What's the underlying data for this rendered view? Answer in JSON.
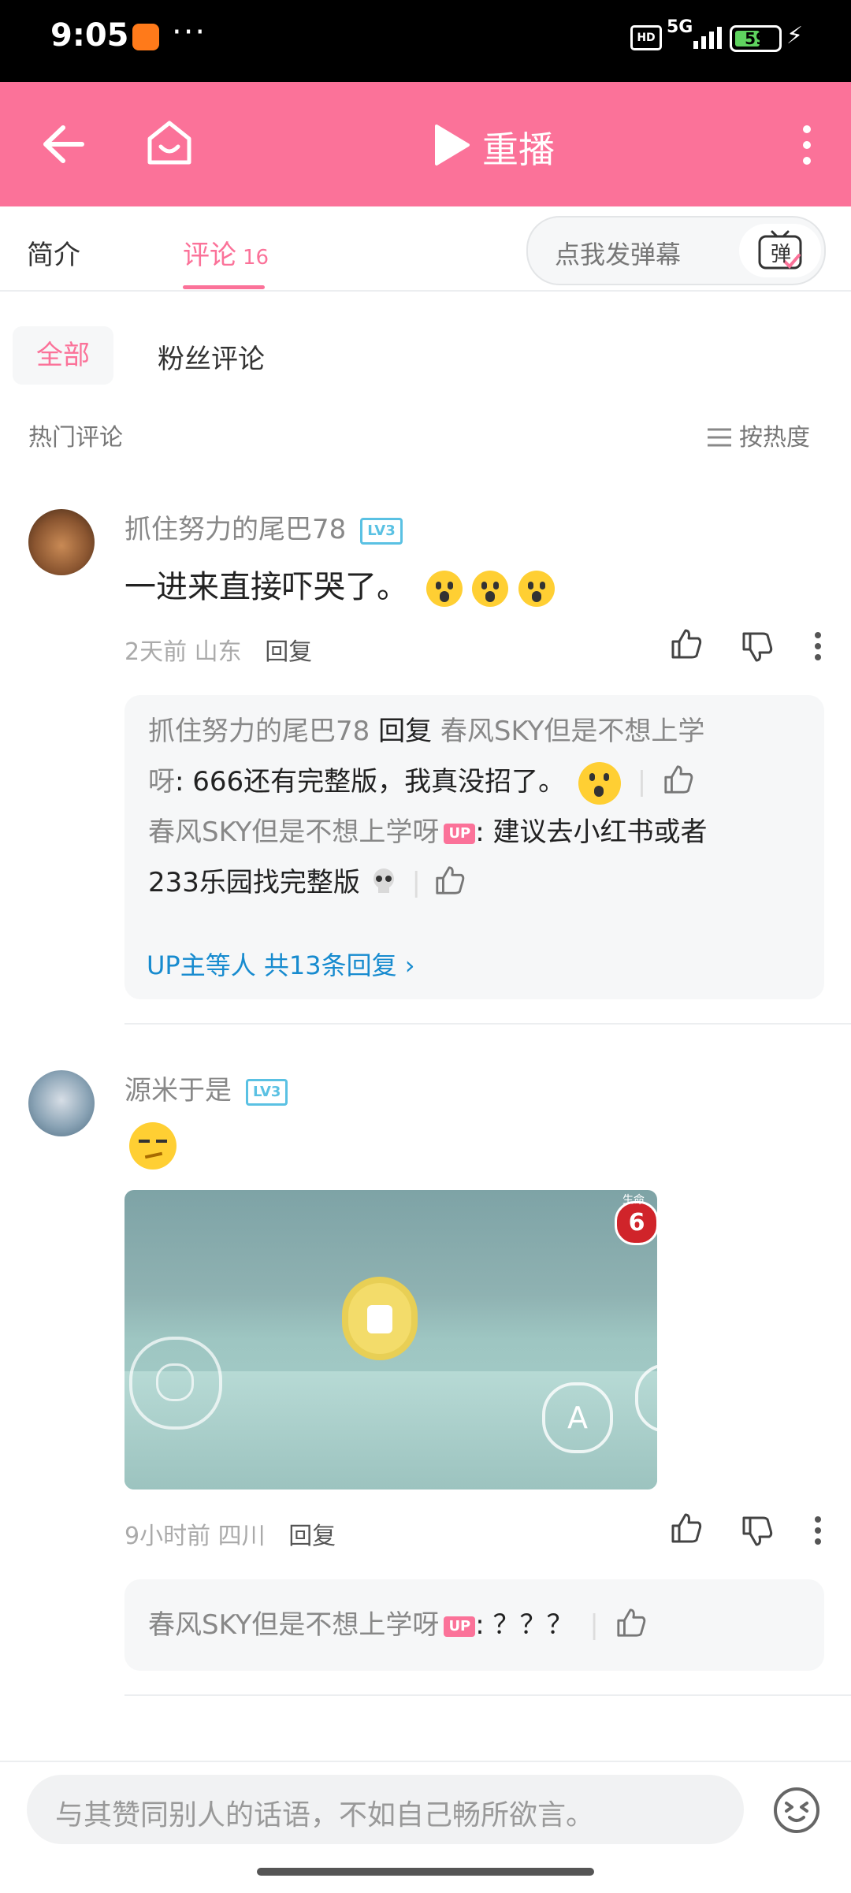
{
  "status_bar": {
    "time": "9:05",
    "more": "···",
    "hd": "HD",
    "signal": "5G",
    "battery": "59",
    "battery_fraction": 0.59
  },
  "nav": {
    "title": "重播"
  },
  "tabs": [
    {
      "label": "简介"
    },
    {
      "label": "评论",
      "count": "16"
    }
  ],
  "danmu": {
    "placeholder": "点我发弹幕",
    "icon_text": "弹"
  },
  "filters": {
    "all": "全部",
    "fans": "粉丝评论"
  },
  "section": {
    "title": "热门评论",
    "sort": "按热度"
  },
  "comments": [
    {
      "user": "抓住努力的尾巴78",
      "level": "LV3",
      "text": "一进来直接吓哭了。",
      "emojis": [
        "scream-emoji",
        "scream-emoji",
        "scream-emoji"
      ],
      "time": "2天前",
      "location": "山东",
      "reply": "回复",
      "replies": [
        {
          "user": "抓住努力的尾巴78",
          "reply_word": "回复",
          "target": "春风SKY但是不想上学",
          "line1_tail": "",
          "line2_target": "呀",
          "text": ": 666还有完整版，我真没招了。",
          "emoji": "laugh-cry-emoji"
        },
        {
          "user": "春风SKY但是不想上学呀",
          "badge": "UP",
          "text": ": 建议去小红书或者",
          "text2": "233乐园找完整版",
          "emoji": "skull-emoji"
        }
      ],
      "more": "UP主等人 共13条回复"
    },
    {
      "user": "源米于是",
      "level": "LV3",
      "emoji": "smirk-emoji",
      "media": {
        "badge_label": "生命",
        "badge_value": "6",
        "button_label": "A"
      },
      "time": "9小时前",
      "location": "四川",
      "reply": "回复",
      "replies": [
        {
          "user": "春风SKY但是不想上学呀",
          "badge": "UP",
          "text": ": ？？？"
        }
      ]
    }
  ],
  "bottom": {
    "placeholder": "与其赞同别人的话语，不如自己畅所欲言。"
  }
}
